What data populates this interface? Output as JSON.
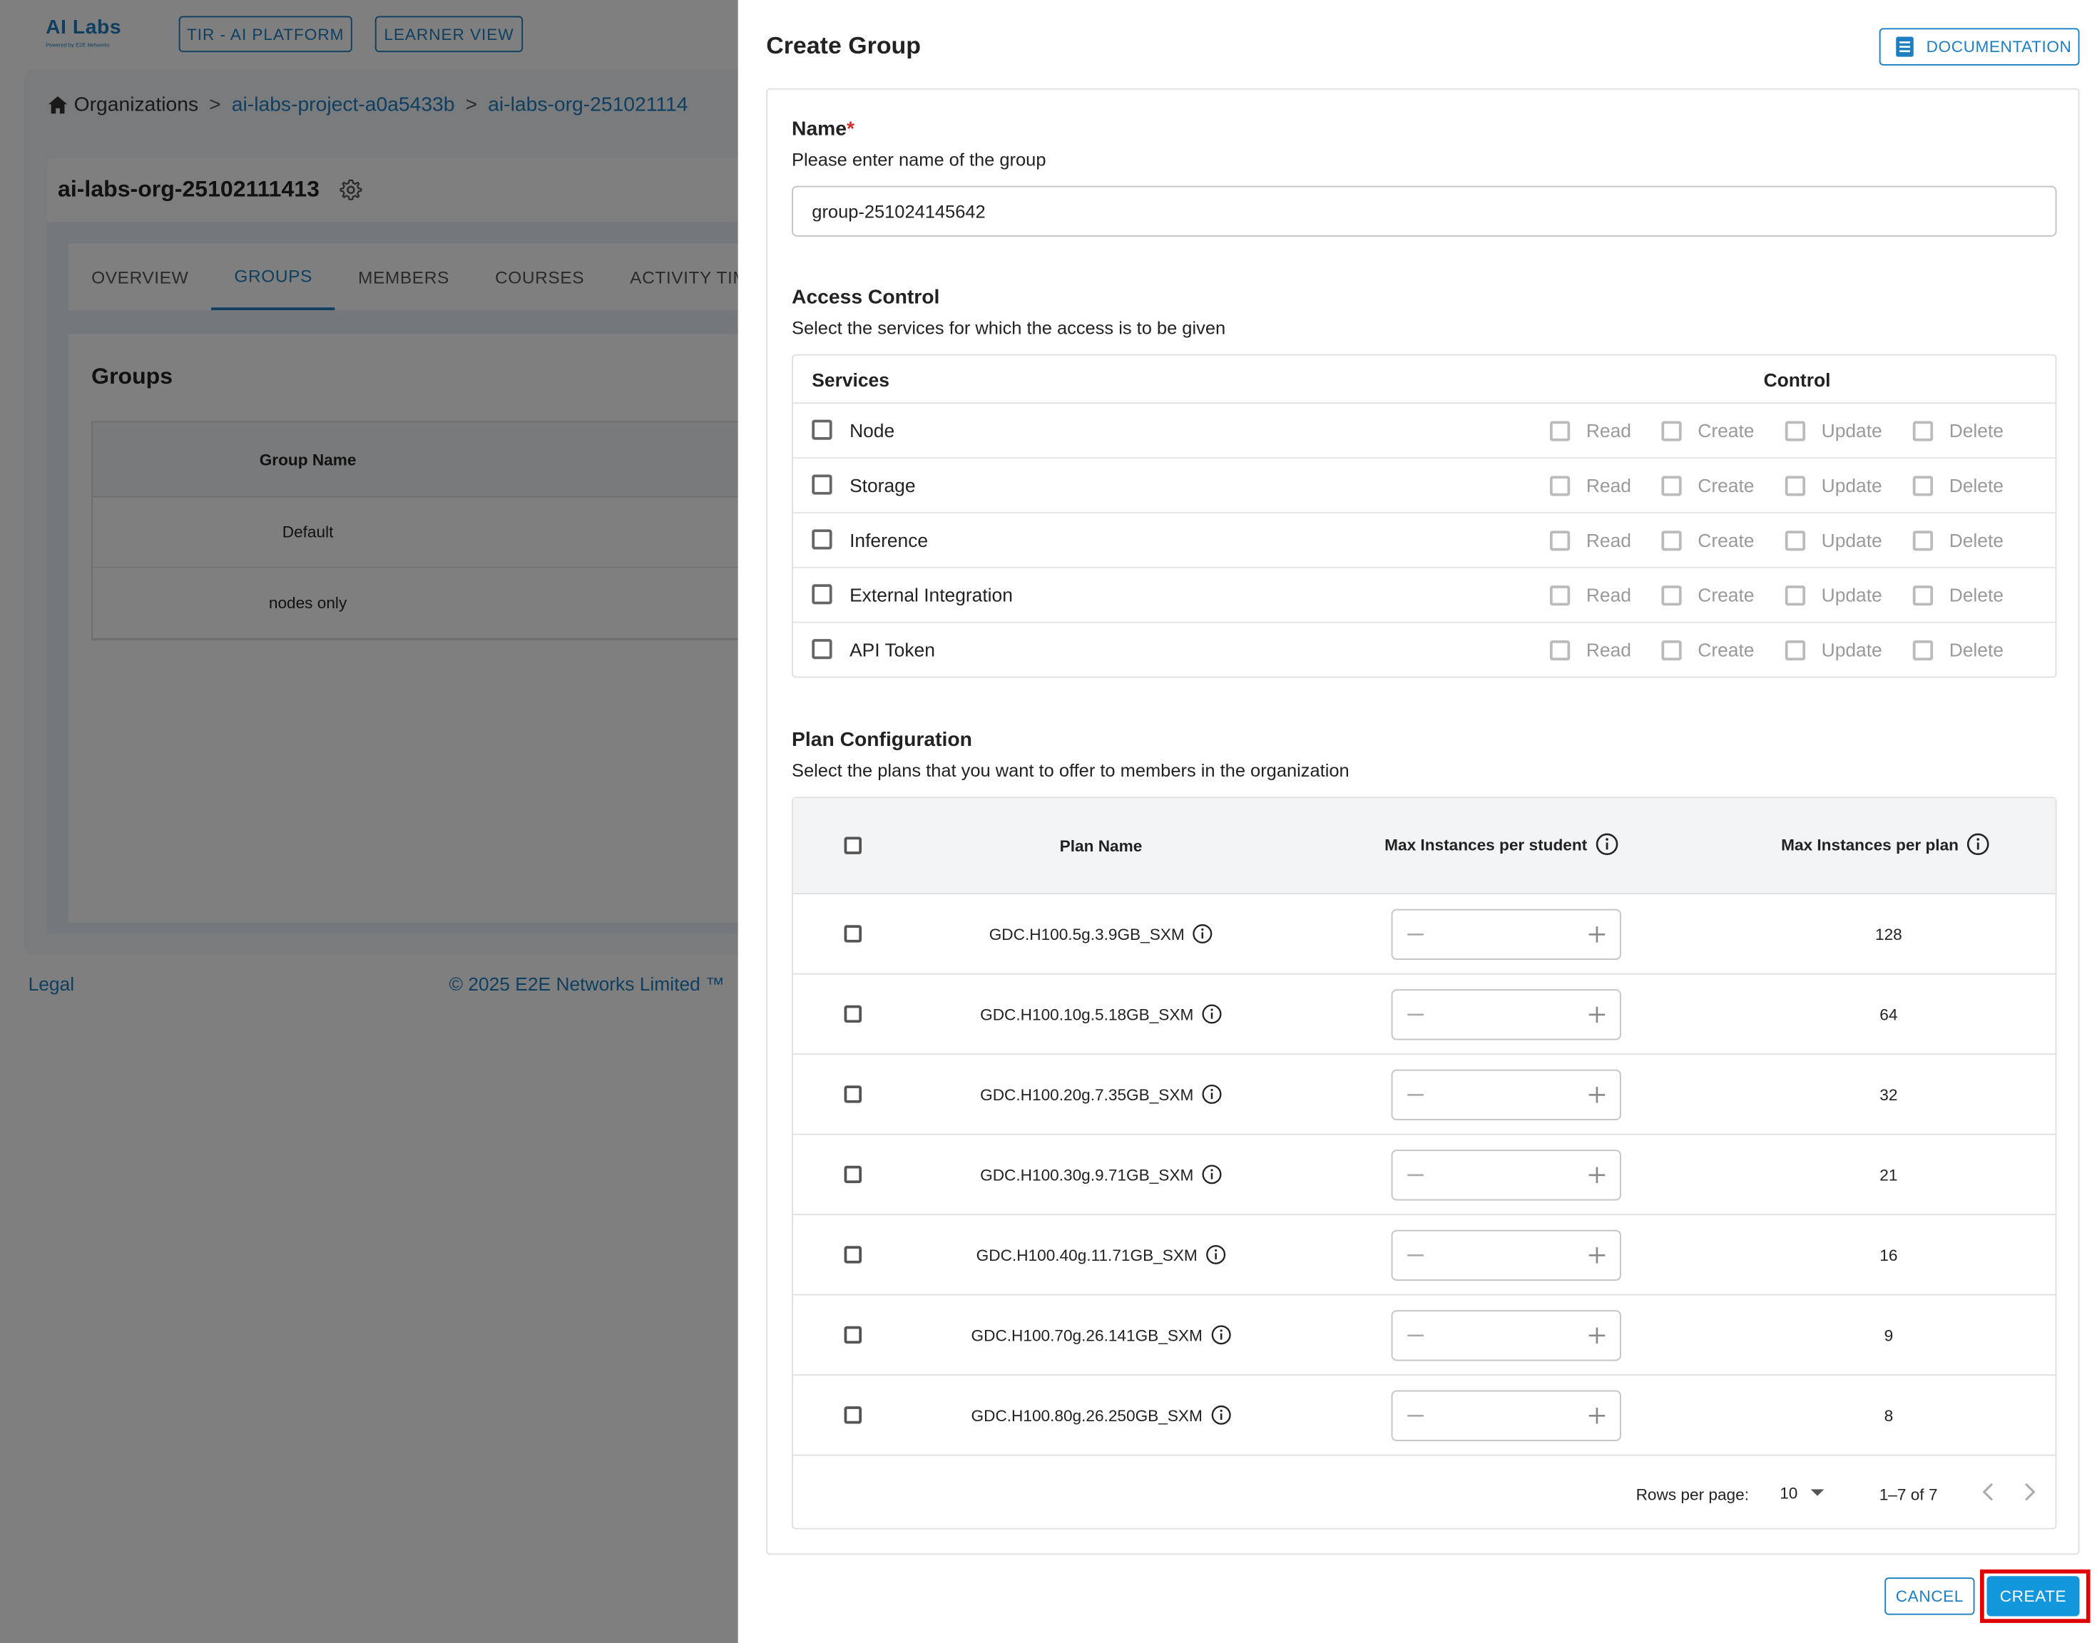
{
  "app": {
    "logo_text": "AI Labs",
    "logo_sub": "Powered by E2E Networks",
    "nav_buttons": [
      "TIR - AI PLATFORM",
      "LEARNER VIEW"
    ]
  },
  "breadcrumb": {
    "home": "Organizations",
    "sep": ">",
    "items": [
      "ai-labs-project-a0a5433b",
      "ai-labs-org-251021114"
    ]
  },
  "org": {
    "title": "ai-labs-org-25102111413",
    "tabs": [
      "OVERVIEW",
      "GROUPS",
      "MEMBERS",
      "COURSES",
      "ACTIVITY TIME"
    ],
    "active_tab": "GROUPS"
  },
  "groups": {
    "title": "Groups",
    "column": "Group Name",
    "rows": [
      "Default",
      "nodes only"
    ]
  },
  "footer": {
    "legal": "Legal",
    "copyright": "© 2025 E2E Networks Limited ™"
  },
  "drawer": {
    "title": "Create Group",
    "doc_button": "DOCUMENTATION",
    "name": {
      "label": "Name",
      "required_mark": "*",
      "hint": "Please enter name of the group",
      "value": "group-251024145642"
    },
    "access": {
      "title": "Access Control",
      "hint": "Select the services for which the access is to be given",
      "col_services": "Services",
      "col_control": "Control",
      "permissions": [
        "Read",
        "Create",
        "Update",
        "Delete"
      ],
      "services": [
        "Node",
        "Storage",
        "Inference",
        "External Integration",
        "API Token"
      ]
    },
    "plans": {
      "title": "Plan Configuration",
      "hint": "Select the plans that you want to offer to members in the organization",
      "col_name": "Plan Name",
      "col_per_student": "Max Instances per student",
      "col_per_plan": "Max Instances per plan",
      "rows": [
        {
          "name": "GDC.H100.5g.3.9GB_SXM",
          "max": "128"
        },
        {
          "name": "GDC.H100.10g.5.18GB_SXM",
          "max": "64"
        },
        {
          "name": "GDC.H100.20g.7.35GB_SXM",
          "max": "32"
        },
        {
          "name": "GDC.H100.30g.9.71GB_SXM",
          "max": "21"
        },
        {
          "name": "GDC.H100.40g.11.71GB_SXM",
          "max": "16"
        },
        {
          "name": "GDC.H100.70g.26.141GB_SXM",
          "max": "9"
        },
        {
          "name": "GDC.H100.80g.26.250GB_SXM",
          "max": "8"
        }
      ],
      "pagination": {
        "rows_per_page_label": "Rows per page:",
        "rows_per_page": "10",
        "range": "1–7 of 7"
      }
    },
    "cancel": "CANCEL",
    "create": "CREATE"
  },
  "colors": {
    "primary": "#1d7fc1",
    "create_button": "#1296dc",
    "highlight": "#e00000",
    "overlay": "rgba(0,0,0,0.5)"
  }
}
